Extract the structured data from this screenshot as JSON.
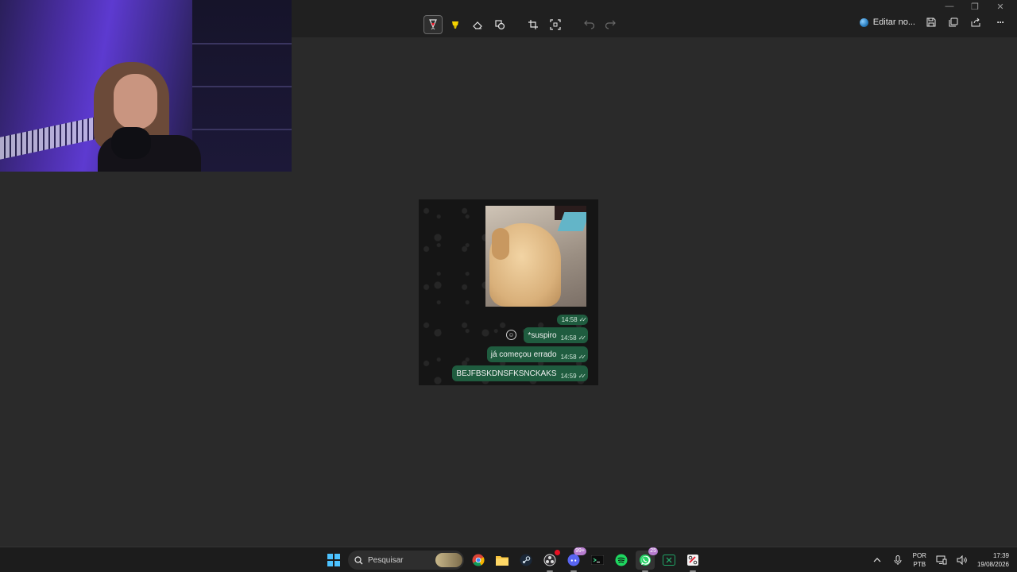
{
  "window": {
    "minimize": "—",
    "restore": "❐",
    "close": "✕"
  },
  "toolbar": {
    "edit_label": "Editar no...",
    "more_label": "···"
  },
  "chat": {
    "image_time": "14:58",
    "messages": [
      {
        "text": "*suspiro",
        "time": "14:58"
      },
      {
        "text": "já começou errado",
        "time": "14:58"
      },
      {
        "text": "BEJFBSKDNSFKSNCKAKS",
        "time": "14:59"
      }
    ],
    "ticks": "✓✓"
  },
  "taskbar": {
    "search_placeholder": "Pesquisar",
    "whatsapp_badge": "25",
    "discord_badge": "99+",
    "lang_top": "POR",
    "lang_bottom": "PTB",
    "time": "17:39",
    "date": "19/08/2026"
  },
  "colors": {
    "accent": "#4cc2ff",
    "bubble": "#1f5c3f",
    "highlighter": "#f5d300",
    "pen": "#e81123"
  }
}
